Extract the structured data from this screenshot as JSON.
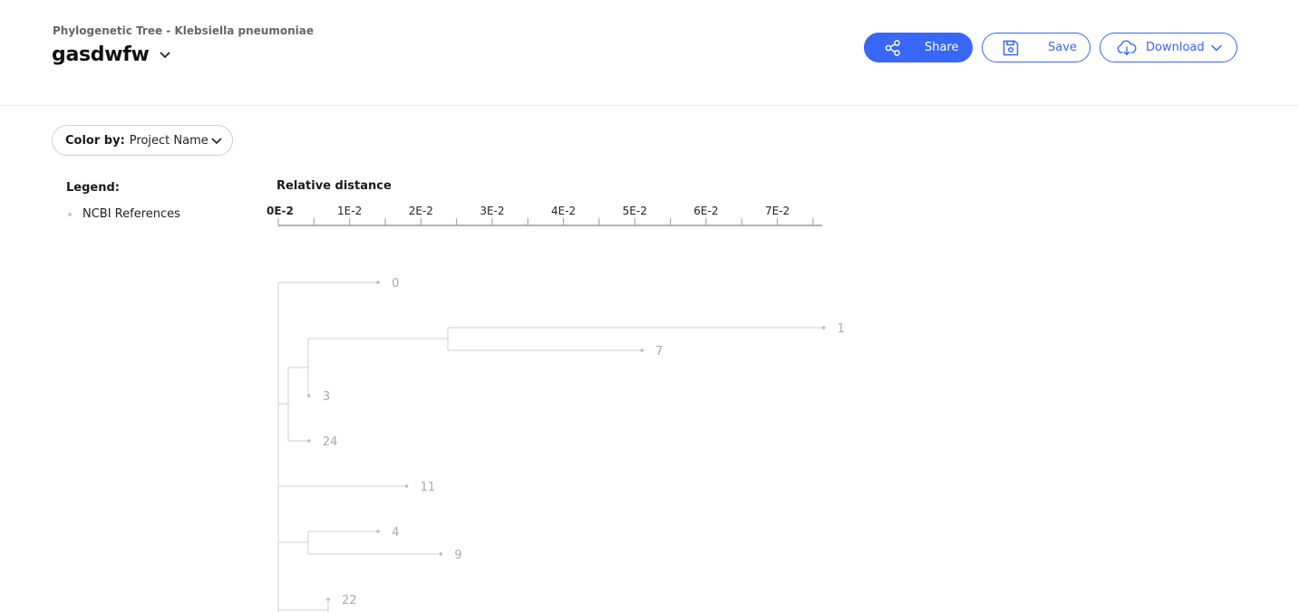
{
  "header": {
    "subtitle": "Phylogenetic Tree - Klebsiella pneumoniae",
    "title": "gasdwfw",
    "share_label": "Share",
    "save_label": "Save",
    "download_label": "Download",
    "accent_color": "#3867fa"
  },
  "controls": {
    "color_by_label": "Color by:",
    "color_by_value": "Project Name"
  },
  "legend": {
    "title": "Legend:",
    "items": [
      {
        "label": "NCBI References",
        "color": "#c8c8c8"
      }
    ]
  },
  "chart_data": {
    "type": "tree",
    "axis_title": "Relative distance",
    "ticks": [
      "0E-2",
      "1E-2",
      "2E-2",
      "3E-2",
      "4E-2",
      "5E-2",
      "6E-2",
      "7E-2"
    ],
    "tick_values": [
      0,
      0.01,
      0.02,
      0.03,
      0.04,
      0.05,
      0.06,
      0.07
    ],
    "leaves": [
      {
        "label": "0",
        "distance": 0.014
      },
      {
        "label": "1",
        "distance": 0.0765
      },
      {
        "label": "7",
        "distance": 0.051
      },
      {
        "label": "3",
        "distance": 0.0043
      },
      {
        "label": "24",
        "distance": 0.0043
      },
      {
        "label": "11",
        "distance": 0.018
      },
      {
        "label": "4",
        "distance": 0.014
      },
      {
        "label": "9",
        "distance": 0.0228
      },
      {
        "label": "22",
        "distance": 0.007
      }
    ],
    "line_color": "#cfcfcf",
    "label_color": "#aaaaaa"
  }
}
